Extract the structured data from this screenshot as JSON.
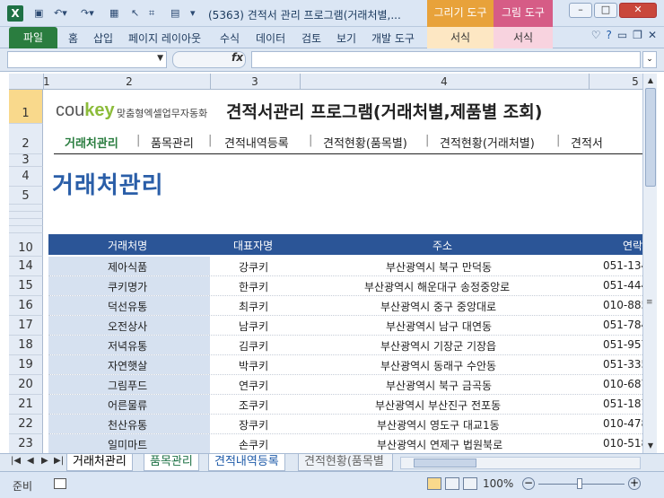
{
  "window": {
    "title": "(5363) 견적서 관리 프로그램(거래처별,...",
    "context_tab1": "그리기 도구",
    "context_tab2": "그림 도구",
    "colors": {
      "excel_green": "#1e7145",
      "header_blue": "#2b5597",
      "context_orange": "#e8a23a",
      "context_pink": "#d65c86"
    }
  },
  "ribbon": {
    "file": "파일",
    "tabs": [
      "홈",
      "삽입",
      "페이지 레이아웃",
      "수식",
      "데이터",
      "검토",
      "보기",
      "개발 도구"
    ],
    "ctx_format1": "서식",
    "ctx_format2": "서식"
  },
  "formula_bar": {
    "fx": "fx",
    "name_box": "",
    "formula": ""
  },
  "columns": [
    "1",
    "2",
    "3",
    "4",
    "5"
  ],
  "rows": [
    "1",
    "2",
    "3",
    "4",
    "5",
    "10",
    "14",
    "15",
    "16",
    "17",
    "18",
    "19",
    "20",
    "21",
    "22",
    "23"
  ],
  "sheet": {
    "logo_brand": "coukey",
    "logo_sub": "맞춤형엑셀업무자동화",
    "title": "견적서관리 프로그램(거래처별,제품별 조회)",
    "nav": [
      "거래처관리",
      "품목관리",
      "견적내역등록",
      "견적현황(품목별)",
      "견적현황(거래처별)",
      "견적서"
    ],
    "page_title": "거래처관리",
    "table": {
      "headers": [
        "거래처명",
        "대표자명",
        "주소",
        "연락"
      ],
      "rows": [
        [
          "제아식품",
          "강쿠키",
          "부산광역시 북구 만덕동",
          "051-134"
        ],
        [
          "쿠키명가",
          "한쿠키",
          "부산광역시 해운대구 송정중앙로",
          "051-444"
        ],
        [
          "덕선유통",
          "최쿠키",
          "부산광역시 중구 중앙대로",
          "010-885"
        ],
        [
          "오전상사",
          "남쿠키",
          "부산광역시 남구 대연동",
          "051-784"
        ],
        [
          "저녁유통",
          "김쿠키",
          "부산광역시 기장군 기장읍",
          "051-957"
        ],
        [
          "자연햇살",
          "박쿠키",
          "부산광역시 동래구 수안동",
          "051-335"
        ],
        [
          "그림푸드",
          "연쿠키",
          "부산광역시 북구 금곡동",
          "010-687"
        ],
        [
          "어른물류",
          "조쿠키",
          "부산광역시 부산진구 전포동",
          "051-187"
        ],
        [
          "천산유통",
          "장쿠키",
          "부산광역시 영도구 대교1동",
          "010-478"
        ],
        [
          "일미마트",
          "손쿠키",
          "부산광역시 연제구 법원북로",
          "010-518"
        ]
      ]
    }
  },
  "sheet_tabs": [
    "거래처관리",
    "품목관리",
    "견적내역등록",
    "견적현황(품목별"
  ],
  "status": {
    "ready": "준비",
    "zoom": "100%"
  }
}
